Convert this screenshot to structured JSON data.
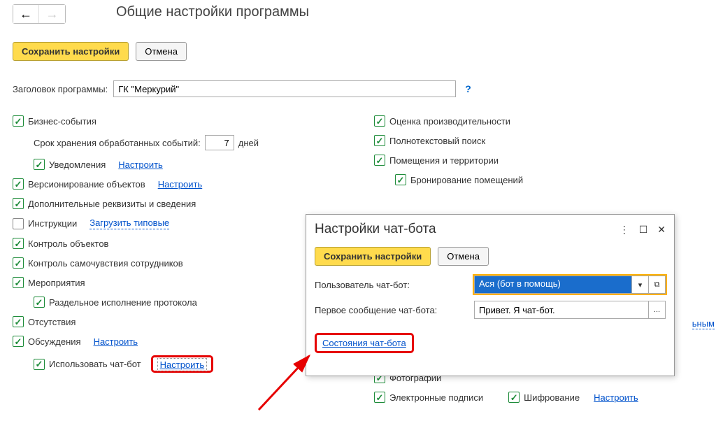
{
  "nav": {
    "back": "←",
    "forward": "→"
  },
  "title": "Общие настройки программы",
  "toolbar": {
    "save": "Сохранить настройки",
    "cancel": "Отмена"
  },
  "programTitle": {
    "label": "Заголовок программы:",
    "value": "ГК \"Меркурий\"",
    "help": "?"
  },
  "left": {
    "biz": "Бизнес-события",
    "period_label": "Срок хранения обработанных событий:",
    "period_value": "7",
    "period_unit": "дней",
    "notif": "Уведомления",
    "configure": "Настроить",
    "versioning": "Версионирование объектов",
    "extra": "Дополнительные реквизиты и сведения",
    "instructions": "Инструкции",
    "loadTypical": "Загрузить типовые",
    "objControl": "Контроль объектов",
    "wellbeing": "Контроль самочувствия сотрудников",
    "events": "Мероприятия",
    "sepProtocol": "Раздельное исполнение протокола",
    "absence": "Отсутствия",
    "discuss": "Обсуждения",
    "useChatbot": "Использовать чат-бот"
  },
  "right": {
    "perf": "Оценка производительности",
    "fullText": "Полнотекстовый поиск",
    "premises": "Помещения и территории",
    "booking": "Бронирование помещений",
    "photos": "Фотографии",
    "esign": "Электронные подписи",
    "encrypt": "Шифрование",
    "configure": "Настроить"
  },
  "popup": {
    "title": "Настройки чат-бота",
    "save": "Сохранить настройки",
    "cancel": "Отмена",
    "userLabel": "Пользователь чат-бот:",
    "userValue": "Ася (бот в помощь)",
    "firstMsgLabel": "Первое сообщение чат-бота:",
    "firstMsgValue": "Привет. Я чат-бот.",
    "statesLink": "Состояния чат-бота",
    "dropdown": "▾",
    "open": "⧉",
    "more": "...",
    "menu": "⋮",
    "max": "☐",
    "close": "✕"
  },
  "peek": "ьным"
}
